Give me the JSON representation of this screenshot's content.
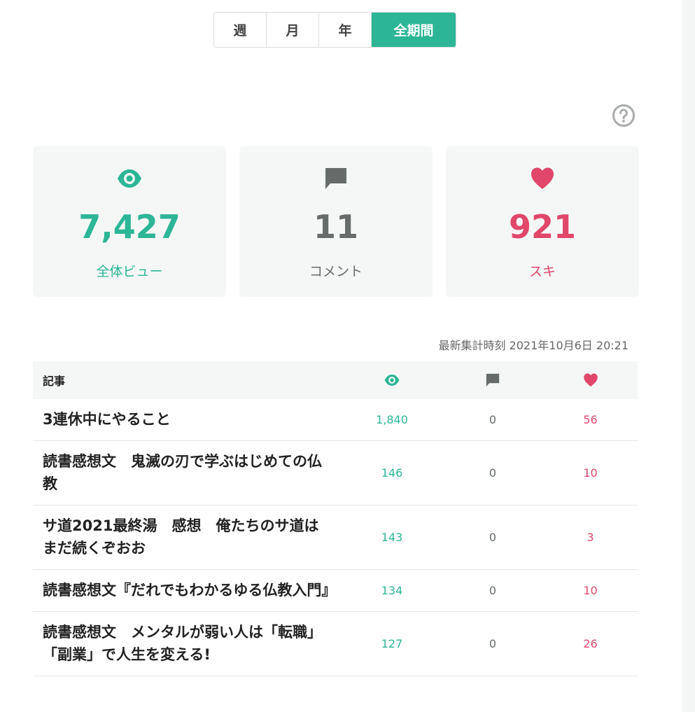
{
  "tabs": [
    {
      "label": "週",
      "active": false
    },
    {
      "label": "月",
      "active": false
    },
    {
      "label": "年",
      "active": false
    },
    {
      "label": "全期間",
      "active": true
    }
  ],
  "stats": {
    "views": {
      "value": "7,427",
      "label": "全体ビュー",
      "icon": "eye-icon"
    },
    "comments": {
      "value": "11",
      "label": "コメント",
      "icon": "comment-icon"
    },
    "likes": {
      "value": "921",
      "label": "スキ",
      "icon": "heart-icon"
    }
  },
  "updated_text": "最新集計時刻 2021年10月6日 20:21",
  "table": {
    "header_title": "記事",
    "rows": [
      {
        "title": "3連休中にやること",
        "views": "1,840",
        "comments": "0",
        "likes": "56"
      },
      {
        "title": "読書感想文　鬼滅の刃で学ぶはじめての仏教",
        "views": "146",
        "comments": "0",
        "likes": "10"
      },
      {
        "title": "サ道2021最終湯　感想　俺たちのサ道はまだ続くぞおお",
        "views": "143",
        "comments": "0",
        "likes": "3"
      },
      {
        "title": "読書感想文『だれでもわかるゆる仏教入門』",
        "views": "134",
        "comments": "0",
        "likes": "10"
      },
      {
        "title": "読書感想文　メンタルが弱い人は「転職」「副業」で人生を変える!",
        "views": "127",
        "comments": "0",
        "likes": "26"
      }
    ]
  },
  "colors": {
    "accent": "#2cb696",
    "like": "#e0476b",
    "neutral": "#666c6a"
  }
}
